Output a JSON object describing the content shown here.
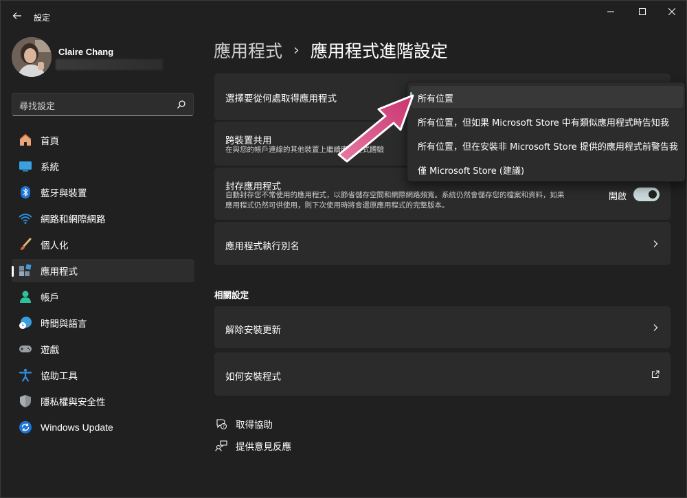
{
  "window": {
    "title": "設定"
  },
  "profile": {
    "name": "Claire Chang"
  },
  "search": {
    "placeholder": "尋找設定"
  },
  "sidebar": {
    "items": [
      {
        "label": "首頁",
        "icon": "home-icon"
      },
      {
        "label": "系統",
        "icon": "system-icon"
      },
      {
        "label": "藍牙與裝置",
        "icon": "bluetooth-icon"
      },
      {
        "label": "網路和網際網路",
        "icon": "wifi-icon"
      },
      {
        "label": "個人化",
        "icon": "brush-icon"
      },
      {
        "label": "應用程式",
        "icon": "apps-icon",
        "selected": true
      },
      {
        "label": "帳戶",
        "icon": "account-icon"
      },
      {
        "label": "時間與語言",
        "icon": "time-language-icon"
      },
      {
        "label": "遊戲",
        "icon": "gamepad-icon"
      },
      {
        "label": "協助工具",
        "icon": "accessibility-icon"
      },
      {
        "label": "隱私權與安全性",
        "icon": "shield-icon"
      },
      {
        "label": "Windows Update",
        "icon": "update-icon"
      }
    ]
  },
  "main": {
    "breadcrumb": {
      "parent": "應用程式",
      "separator": "›",
      "current": "應用程式進階設定"
    },
    "cards": {
      "source": {
        "title": "選擇要從何處取得應用程式"
      },
      "share": {
        "title": "跨裝置共用",
        "desc": "在與您的帳戶連線的其他裝置上繼續應用程式體驗"
      },
      "archive": {
        "title": "封存應用程式",
        "desc_line1": "自動封存您不常使用的應用程式，以節省儲存空間和網際網路頻寬。系統仍然會儲存您的檔案和資料，如果",
        "desc_line2": "應用程式仍然可供使用，則下次使用時將會還原應用程式的完整版本。",
        "toggle_label": "開啟",
        "toggle_on": true
      },
      "alias": {
        "title": "應用程式執行別名"
      }
    },
    "related": {
      "heading": "相關設定",
      "uninstall_updates": "解除安裝更新",
      "how_to_install": "如何安裝程式"
    },
    "links": {
      "help": "取得協助",
      "feedback": "提供意見反應"
    }
  },
  "dropdown": {
    "options": [
      "所有位置",
      "所有位置，但如果 Microsoft Store 中有類似應用程式時告知我",
      "所有位置，但在安裝非 Microsoft Store 提供的應用程式前警告我",
      "僅 Microsoft Store (建議)"
    ],
    "selected_index": 0
  },
  "colors": {
    "background": "#202020",
    "card": "#2b2b2b",
    "accent": "#8fbdcb",
    "annotation_arrow": "#d4457e"
  }
}
